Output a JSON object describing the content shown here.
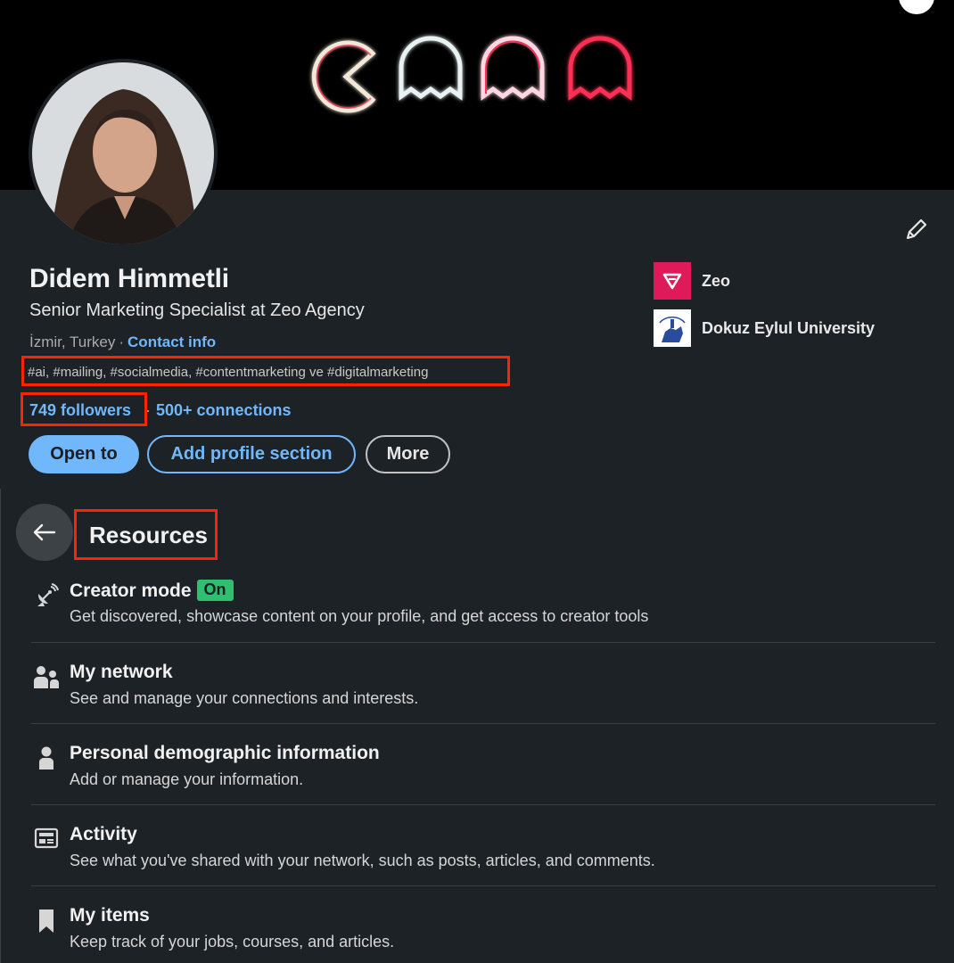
{
  "profile": {
    "name": "Didem Himmetli",
    "headline": "Senior Marketing Specialist at Zeo Agency",
    "location": "İzmir, Turkey",
    "separator": "·",
    "contact_info": "Contact info",
    "hashtags": "#ai, #mailing, #socialmedia, #contentmarketing ve #digitalmarketing",
    "followers": "749 followers",
    "connections": "500+ connections"
  },
  "actions": {
    "open_to": "Open to",
    "add_profile_section": "Add profile section",
    "more": "More"
  },
  "organizations": [
    {
      "name": "Zeo",
      "icon": "zeo-logo"
    },
    {
      "name": "Dokuz Eylul University",
      "icon": "university-logo"
    }
  ],
  "resources": {
    "title": "Resources",
    "items": [
      {
        "title": "Creator mode",
        "badge": "On",
        "description": "Get discovered, showcase content on your profile, and get access to creator tools",
        "icon": "satellite-dish-icon"
      },
      {
        "title": "My network",
        "description": "See and manage your connections and interests.",
        "icon": "people-icon"
      },
      {
        "title": "Personal demographic information",
        "description": "Add or manage your information.",
        "icon": "person-icon"
      },
      {
        "title": "Activity",
        "description": "See what you've shared with your network, such as posts, articles, and comments.",
        "icon": "newspaper-icon"
      },
      {
        "title": "My items",
        "description": "Keep track of your jobs, courses, and articles.",
        "icon": "bookmark-icon"
      }
    ]
  },
  "colors": {
    "link": "#71b7fb",
    "highlight": "#ff2400",
    "badge": "#2fbf71",
    "background": "#1d2226"
  }
}
